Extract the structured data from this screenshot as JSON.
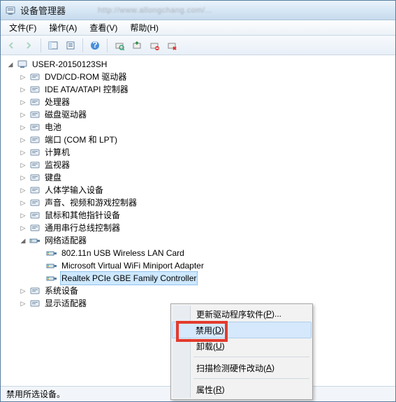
{
  "titlebar": {
    "title": "设备管理器"
  },
  "menubar": {
    "file": "文件(F)",
    "action": "操作(A)",
    "view": "查看(V)",
    "help": "帮助(H)"
  },
  "toolbar_icons": {
    "back": "back-icon",
    "forward": "forward-icon",
    "properties": "properties-icon",
    "help": "help-icon",
    "refresh": "refresh-icon",
    "update": "update-icon",
    "disable": "disable-icon",
    "uninstall": "uninstall-icon"
  },
  "tree": {
    "root": "USER-20150123SH",
    "categories": [
      {
        "label": "DVD/CD-ROM 驱动器"
      },
      {
        "label": "IDE ATA/ATAPI 控制器"
      },
      {
        "label": "处理器"
      },
      {
        "label": "磁盘驱动器"
      },
      {
        "label": "电池"
      },
      {
        "label": "端口 (COM 和 LPT)"
      },
      {
        "label": "计算机"
      },
      {
        "label": "监视器"
      },
      {
        "label": "键盘"
      },
      {
        "label": "人体学输入设备"
      },
      {
        "label": "声音、视频和游戏控制器"
      },
      {
        "label": "鼠标和其他指针设备"
      },
      {
        "label": "通用串行总线控制器"
      },
      {
        "label": "网络适配器",
        "expanded": true,
        "children": [
          {
            "label": "802.11n USB Wireless LAN Card"
          },
          {
            "label": "Microsoft Virtual WiFi Miniport Adapter"
          },
          {
            "label": "Realtek PCIe GBE Family Controller",
            "selected": true
          }
        ]
      },
      {
        "label": "系统设备"
      },
      {
        "label": "显示适配器"
      }
    ]
  },
  "context_menu": {
    "items": [
      {
        "label": "更新驱动程序软件(P)...",
        "key": "P"
      },
      {
        "label": "禁用(D)",
        "key": "D",
        "highlighted": true
      },
      {
        "label": "卸载(U)",
        "key": "U"
      },
      {
        "sep": true
      },
      {
        "label": "扫描检测硬件改动(A)",
        "key": "A"
      },
      {
        "sep": true
      },
      {
        "label": "属性(R)",
        "key": "R"
      }
    ]
  },
  "statusbar": {
    "text": "禁用所选设备。"
  }
}
